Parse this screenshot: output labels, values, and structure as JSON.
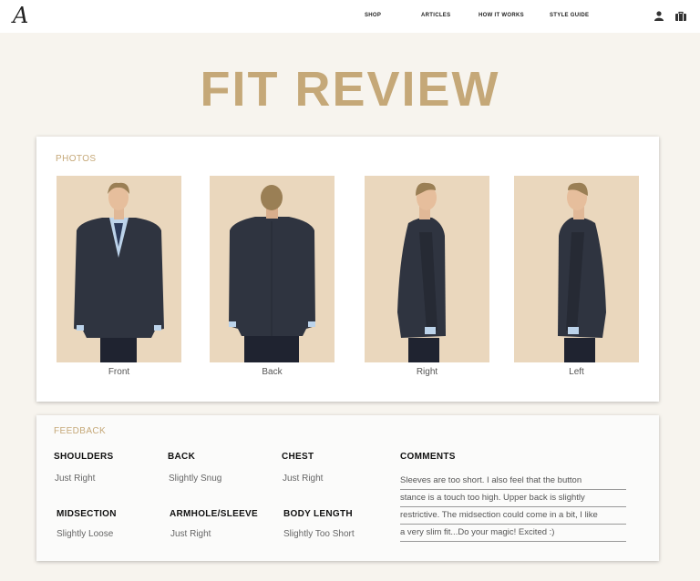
{
  "header": {
    "logo_text": "A",
    "nav": [
      "SHOP",
      "ARTICLES",
      "HOW IT WORKS",
      "STYLE GUIDE"
    ],
    "icons": [
      "user-icon",
      "shopping-bag-icon"
    ]
  },
  "page": {
    "title": "FIT REVIEW"
  },
  "photos": {
    "label": "PHOTOS",
    "items": [
      {
        "caption": "Front"
      },
      {
        "caption": "Back"
      },
      {
        "caption": "Right"
      },
      {
        "caption": "Left"
      }
    ]
  },
  "feedback": {
    "label": "FEEDBACK",
    "items": [
      {
        "label": "SHOULDERS",
        "value": "Just Right"
      },
      {
        "label": "BACK",
        "value": "Slightly Snug"
      },
      {
        "label": "CHEST",
        "value": "Just Right"
      },
      {
        "label": "MIDSECTION",
        "value": "Slightly Loose"
      },
      {
        "label": "ARMHOLE/SLEEVE",
        "value": "Just Right"
      },
      {
        "label": "BODY LENGTH",
        "value": "Slightly Too Short"
      }
    ],
    "comments_label": "COMMENTS",
    "comments_lines": [
      "Sleeves are too short. I also feel that the button",
      "stance is a touch too high. Upper back is slightly",
      "restrictive. The midsection could come in a bit, I like",
      "a very slim fit...Do your magic! Excited :)"
    ]
  },
  "colors": {
    "accent": "#c5a878",
    "background": "#f7f4ee",
    "photo_backdrop": "#ead7bd",
    "suit": "#2f3440"
  }
}
